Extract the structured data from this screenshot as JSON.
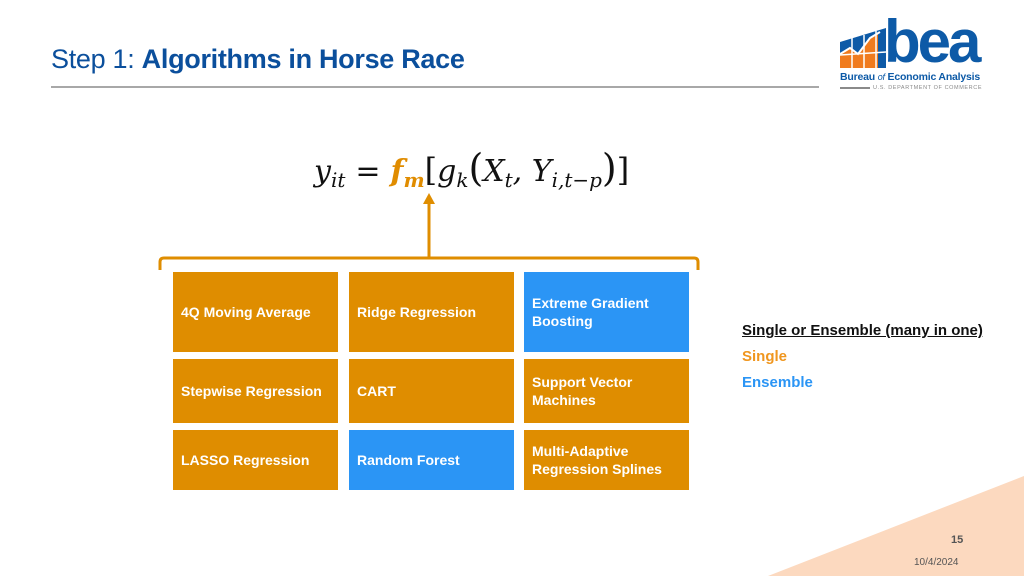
{
  "header": {
    "title_prefix": "Step 1: ",
    "title_main": "Algorithms in Horse Race"
  },
  "logo": {
    "wordmark": "bea",
    "name_part1": "Bureau ",
    "name_of": "of",
    "name_part2": " Economic Analysis",
    "department": "U.S. DEPARTMENT OF COMMERCE"
  },
  "formula": {
    "lhs": "y",
    "lhs_sub": "it",
    "equals": "=",
    "f": "f",
    "f_sub": "m",
    "open_bracket": "[",
    "g": "g",
    "g_sub": "k",
    "open_paren": "(",
    "x": "X",
    "x_sub": "t",
    "comma": ", ",
    "y": "Y",
    "y_sub": "i,t−p",
    "close_paren": ")",
    "close_bracket": "]"
  },
  "algorithms": [
    {
      "label": "4Q Moving Average",
      "type": "single"
    },
    {
      "label": "Ridge Regression",
      "type": "single"
    },
    {
      "label": "Extreme Gradient Boosting",
      "type": "ensemble"
    },
    {
      "label": "Stepwise Regression",
      "type": "single"
    },
    {
      "label": "CART",
      "type": "single"
    },
    {
      "label": "Support Vector Machines",
      "type": "single"
    },
    {
      "label": "LASSO Regression",
      "type": "single"
    },
    {
      "label": "Random Forest",
      "type": "ensemble"
    },
    {
      "label": "Multi-Adaptive Regression Splines",
      "type": "single"
    }
  ],
  "legend": {
    "header": "Single or Ensemble (many in one)",
    "single": "Single",
    "ensemble": "Ensemble"
  },
  "colors": {
    "single": "#df8d00",
    "ensemble": "#2b95f5",
    "title": "#0b4f9c",
    "accent_triangle": "#fcd9bf"
  },
  "footer": {
    "page_number": "15",
    "date": "10/4/2024"
  }
}
